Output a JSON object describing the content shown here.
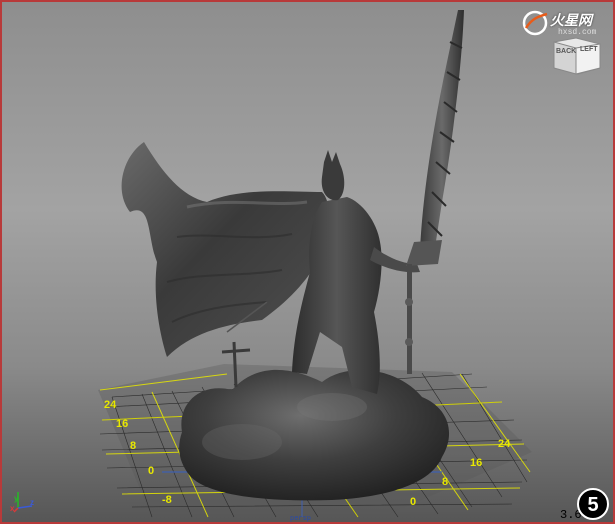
{
  "app": {
    "watermark_title": "火星网",
    "watermark_url": "hxsd.com"
  },
  "viewcube": {
    "face_back": "BACK",
    "face_left": "LEFT"
  },
  "grid": {
    "left_ticks": [
      "24",
      "16",
      "8",
      "0",
      "-8"
    ],
    "right_ticks": [
      "24",
      "16",
      "8",
      "0"
    ]
  },
  "step_badge": "5",
  "readout": "3.6",
  "camera_label": "persp",
  "axes": {
    "x": "x",
    "y": "y",
    "z": "z"
  },
  "colors": {
    "frame_border": "#b83a3a",
    "grid_major": "#e8e800",
    "grid_minor": "#2a2a2a",
    "model": "#4a4a4a"
  }
}
